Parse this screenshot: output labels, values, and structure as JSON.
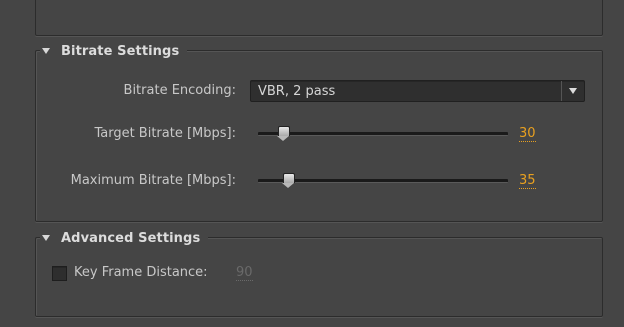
{
  "bitrate_settings": {
    "title": "Bitrate Settings",
    "encoding_label": "Bitrate Encoding:",
    "encoding_value": "VBR, 2 pass",
    "target_label": "Target Bitrate [Mbps]:",
    "target_value": "30",
    "target_level": 0.1,
    "max_label": "Maximum Bitrate [Mbps]:",
    "max_value": "35",
    "max_level": 0.12
  },
  "advanced_settings": {
    "title": "Advanced Settings",
    "keyframe_label": "Key Frame Distance:",
    "keyframe_value": "90",
    "keyframe_checked": false
  },
  "colors": {
    "accent": "#e8a020",
    "panel_bg": "#454545"
  },
  "icons": {
    "collapse": "triangle-down-icon",
    "dropdown": "chevron-down-icon"
  }
}
